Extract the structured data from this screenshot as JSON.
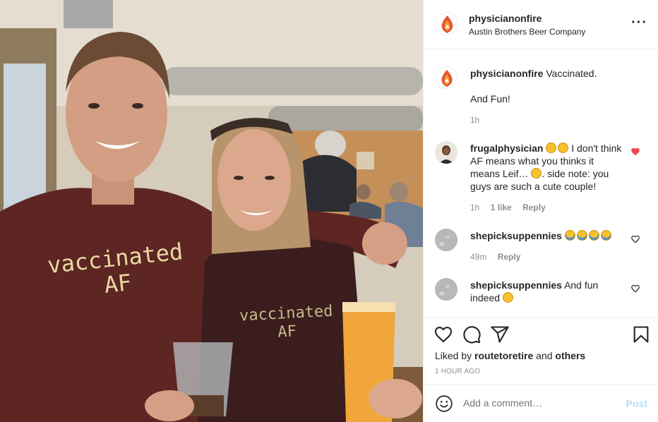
{
  "post": {
    "username": "physicianonfire",
    "location": "Austin Brothers Beer Company",
    "more_icon": "more-horizontal-icon"
  },
  "photo": {
    "shirt_text_left_line1": "vaccinated",
    "shirt_text_left_line2": "AF",
    "shirt_text_right_line1": "vaccinated",
    "shirt_text_right_line2": "AF"
  },
  "caption": {
    "username": "physicianonfire",
    "text_line1": "Vaccinated.",
    "text_line2": "And Fun!",
    "time": "1h"
  },
  "comments": [
    {
      "username": "frugalphysician",
      "text_a": " I don't think AF means what you thinks it means Leif…",
      "text_b": ". side note: you guys are such a cute couple!",
      "time": "1h",
      "likes": "1 like",
      "reply": "Reply",
      "liked": true
    },
    {
      "username": "shepicksuppennies",
      "text": "",
      "time": "49m",
      "reply": "Reply",
      "liked": false
    },
    {
      "username": "shepicksuppennies",
      "text": "And fun indeed",
      "liked": false
    }
  ],
  "likes": {
    "prefix": "Liked by ",
    "user": "routetoretire",
    "middle": " and ",
    "others": "others"
  },
  "timestamp": "1 HOUR AGO",
  "add_comment": {
    "placeholder": "Add a comment…",
    "post_label": "Post"
  },
  "colors": {
    "like_red": "#ed4956",
    "post_disabled": "#b2dffc",
    "meta_gray": "#8e8e8e"
  }
}
